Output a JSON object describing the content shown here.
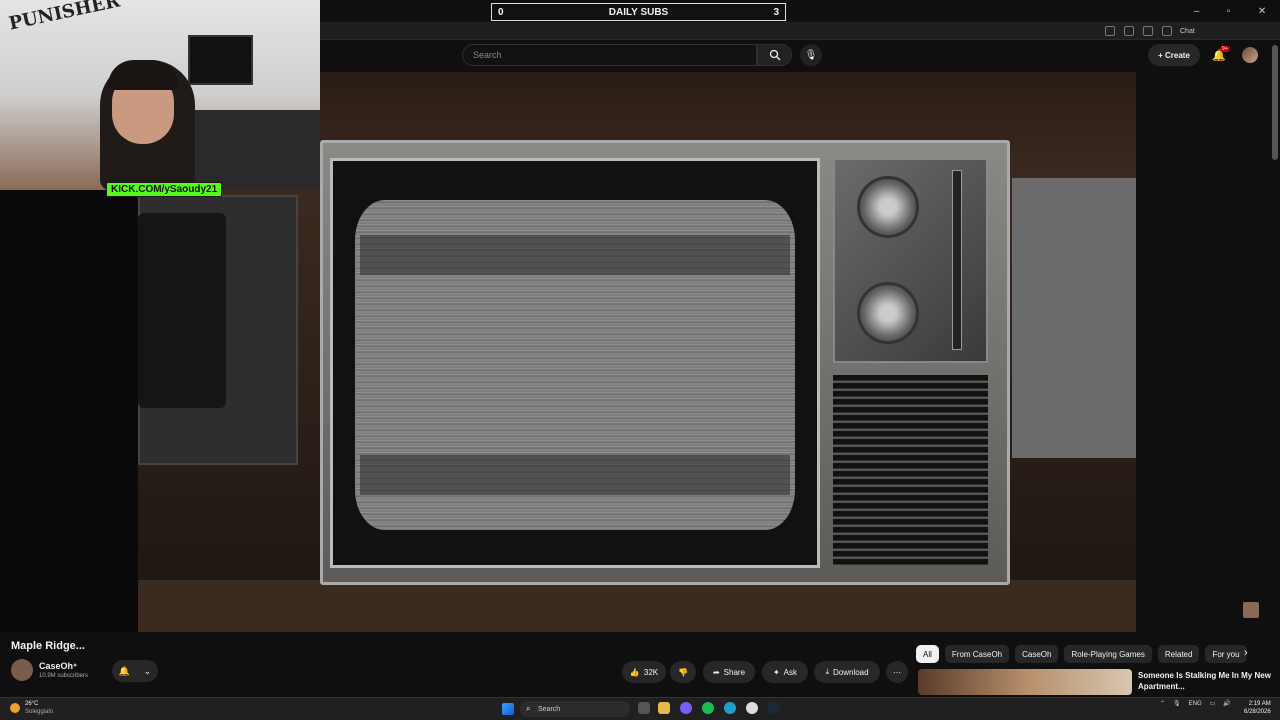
{
  "overlay": {
    "subs_title": "DAILY SUBS",
    "subs_left": "0",
    "subs_right": "3",
    "kick_url": "KICK.COM/ySaoudy21",
    "logo_text": "PUNISHER"
  },
  "browser": {
    "chat_label": "Chat"
  },
  "header": {
    "search_placeholder": "Search",
    "create_label": "Create",
    "notif_badge": "9+"
  },
  "video": {
    "title": "Maple Ridge..."
  },
  "channel": {
    "name": "CaseOh",
    "subscribers": "10.9M subscribers"
  },
  "actions": {
    "likes": "32K",
    "share": "Share",
    "ask": "Ask",
    "download": "Download"
  },
  "chips": [
    "All",
    "From CaseOh",
    "CaseOh",
    "Role-Playing Games",
    "Related",
    "For you"
  ],
  "recommended": {
    "title": "Someone Is Stalking Me In My New Apartment..."
  },
  "taskbar": {
    "weather_temp": "26°C",
    "weather_desc": "Soleggiato",
    "search_label": "Search",
    "language": "ENG",
    "time": "2:19 AM",
    "date": "6/28/2026"
  },
  "colors": {
    "kick_green": "#53fc18",
    "bg": "#0f0f0f",
    "chip_active": "#f1f1f1",
    "notif_red": "#cc0000"
  }
}
